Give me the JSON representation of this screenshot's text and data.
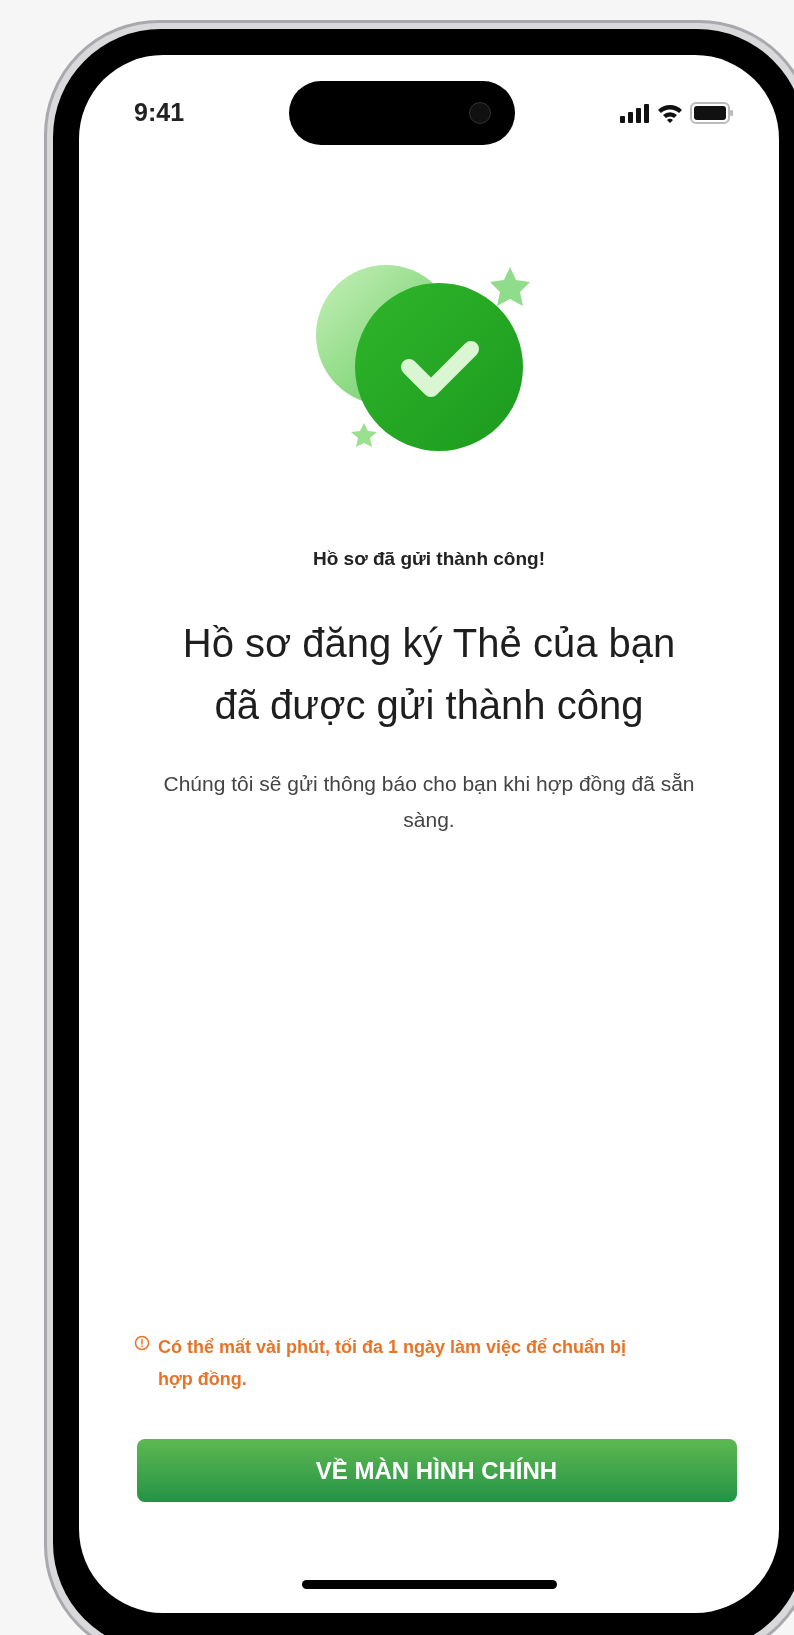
{
  "status_bar": {
    "time": "9:41"
  },
  "caption": "Hồ sơ đã gửi thành công!",
  "heading": "Hồ sơ đăng ký Thẻ của bạn đã được gửi thành công",
  "message": "Chúng tôi sẽ gửi thông báo cho bạn khi hợp đồng đã sẵn sàng.",
  "notice": "Có thể mất vài phút, tối đa 1 ngày làm việc để chuẩn bị hợp đồng.",
  "button": {
    "label": "VỀ MÀN HÌNH CHÍNH"
  }
}
